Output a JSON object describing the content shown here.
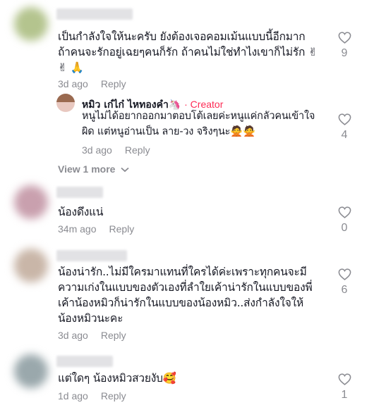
{
  "comments": [
    {
      "text": "เป็นกำลังใจให้นะครับ ยังต้องเจอคอมเม้นแบบนี้อีกมาก ถ้าคนจะรักอยู่เฉยๆคนก็รัก ถ้าคนไม่ใช่ทำไงเขาก็ไม่รัก ✌✌ 🙏",
      "time": "3d ago",
      "reply": "Reply",
      "likes": "9",
      "avatar_color": "#b4c48e"
    },
    {
      "text": "น้องดึงแน่",
      "time": "34m ago",
      "reply": "Reply",
      "likes": "0",
      "avatar_color": "#c9a0ae"
    },
    {
      "text": "น้องน่ารัก..ไม่มีใครมาแทนที่ใครได้ค่ะเพราะทุกคนจะมีความเก่งในแบบของตัวเองที่ลำใยเค้าน่ารักในแบบของพี่เค้าน้องหมิวก็น่ารักในแบบของน้องหมิว..ส่งกำลังใจให้น้องหมิวนะคะ",
      "time": "3d ago",
      "reply": "Reply",
      "likes": "6",
      "avatar_color": "#c9b6a8"
    },
    {
      "text": "แต่ใดๆ น้องหมิวสวยงับ🥰",
      "time": "1d ago",
      "reply": "Reply",
      "likes": "1",
      "avatar_color": "#9aa8ac"
    }
  ],
  "creator_reply": {
    "name": "หมิว เก๋ไก๋ ไหทองคำ🦄",
    "tag": "· Creator",
    "text": "หนูไม่ได้อยากออกมาตอบโต้เลยค่ะหนูแค่กลัวคนเข้าใจผิด แต่หนูอ่านเป็น ลาย-วง จริงๆนะ🙅🙅",
    "time": "3d ago",
    "reply": "Reply",
    "likes": "4"
  },
  "view_more": "View 1 more",
  "colors": {
    "accent": "#fe2c55",
    "muted": "#8a8b91",
    "text": "#161823"
  }
}
